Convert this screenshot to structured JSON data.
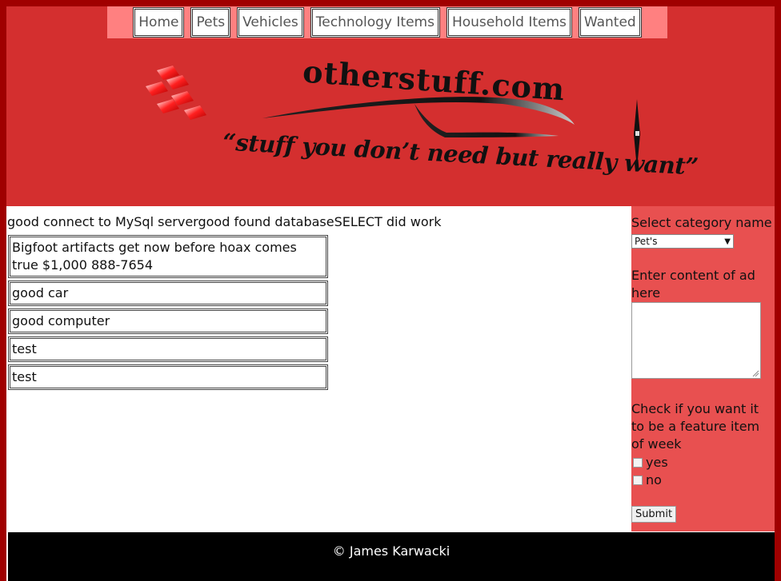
{
  "nav": {
    "items": [
      "Home",
      "Pets",
      "Vehicles",
      "Technology Items",
      "Household Items",
      "Wanted"
    ]
  },
  "logo": {
    "title": "otherstuff.com",
    "tagline": "“stuff you don’t need but really want”"
  },
  "main": {
    "status": "good connect to MySql servergood found databaseSELECT did work",
    "ads": [
      "Bigfoot artifacts get now before hoax comes true $1,000 888-7654",
      "good car",
      "good computer",
      "test",
      "test"
    ]
  },
  "sidebar": {
    "category_label": "Select category name",
    "category_value": "Pet's",
    "content_label": "Enter content of ad here",
    "feature_label": "Check if you want it to be a feature item of week",
    "yes_label": "yes",
    "no_label": "no",
    "submit_label": "Submit"
  },
  "footer": {
    "text": "© James Karwacki"
  },
  "colors": {
    "page_border": "#a00000",
    "header_bg": "#d42f2f",
    "nav_bg": "#ff8080",
    "sidebar_bg": "#e85050",
    "footer_bg": "#000000"
  }
}
